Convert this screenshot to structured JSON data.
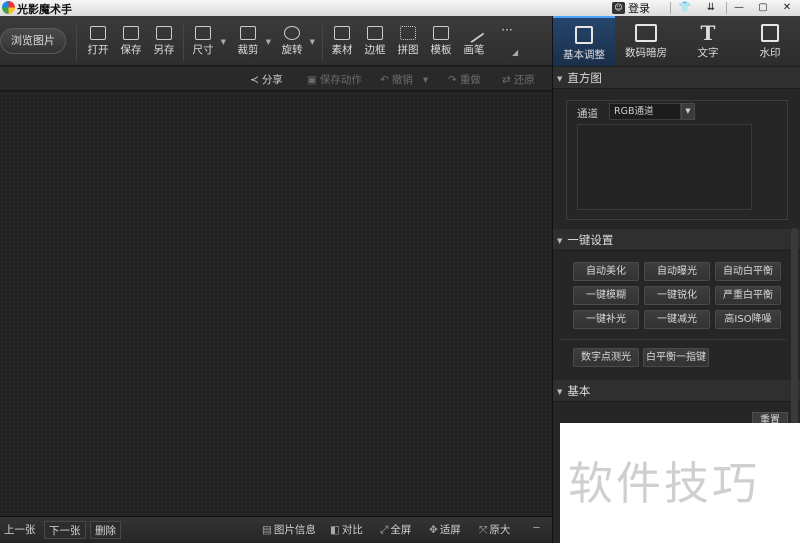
{
  "app": {
    "title": "光影魔术手",
    "login_label": "登录"
  },
  "titlebar": {
    "buttons": [
      "👕",
      "⇊",
      "—",
      "▢",
      "✕"
    ]
  },
  "toolbar": {
    "browse_label": "浏览图片",
    "tools": [
      {
        "label": "打开",
        "icon": "open-icon"
      },
      {
        "label": "保存",
        "icon": "save-icon"
      },
      {
        "label": "另存",
        "icon": "save-as-icon"
      },
      {
        "label": "尺寸",
        "icon": "resize-icon"
      },
      {
        "label": "裁剪",
        "icon": "crop-icon"
      },
      {
        "label": "旋转",
        "icon": "rotate-icon"
      },
      {
        "label": "素材",
        "icon": "material-icon"
      },
      {
        "label": "边框",
        "icon": "border-icon"
      },
      {
        "label": "拼图",
        "icon": "collage-icon"
      },
      {
        "label": "模板",
        "icon": "template-icon"
      },
      {
        "label": "画笔",
        "icon": "brush-icon"
      },
      {
        "label": "",
        "icon": "more-icon"
      }
    ]
  },
  "right_tabs": [
    {
      "label": "基本调整",
      "icon": "basic-adjust-icon",
      "active": true
    },
    {
      "label": "数码暗房",
      "icon": "darkroom-icon",
      "active": false
    },
    {
      "label": "文字",
      "icon": "text-icon",
      "glyph": "T",
      "active": false
    },
    {
      "label": "水印",
      "icon": "watermark-icon",
      "active": false
    }
  ],
  "actionbar": {
    "share": "分享",
    "save_action": "保存动作",
    "undo": "撤销",
    "redo": "重做",
    "restore": "还原"
  },
  "bottombar": {
    "prev": "上一张",
    "next": "下一张",
    "delete": "删除",
    "info": "图片信息",
    "compare": "对比",
    "fullscreen": "全屏",
    "fit": "适屏",
    "original": "原大"
  },
  "panel": {
    "histogram": {
      "title": "直方图",
      "channel_label": "通道",
      "channel_value": "RGB通道"
    },
    "oneclick": {
      "title": "一键设置",
      "buttons": [
        "自动美化",
        "自动曝光",
        "自动白平衡",
        "一键模糊",
        "一键锐化",
        "严重白平衡",
        "一键补光",
        "一键减光",
        "高ISO降噪"
      ],
      "extra_buttons": [
        "数字点测光",
        "白平衡一指键"
      ]
    },
    "basic": {
      "title": "基本",
      "reset_label": "重置"
    }
  },
  "watermark_text": "软件技巧",
  "colors": {
    "accent": "#4fa3ff",
    "active_tab": "#26466c"
  }
}
